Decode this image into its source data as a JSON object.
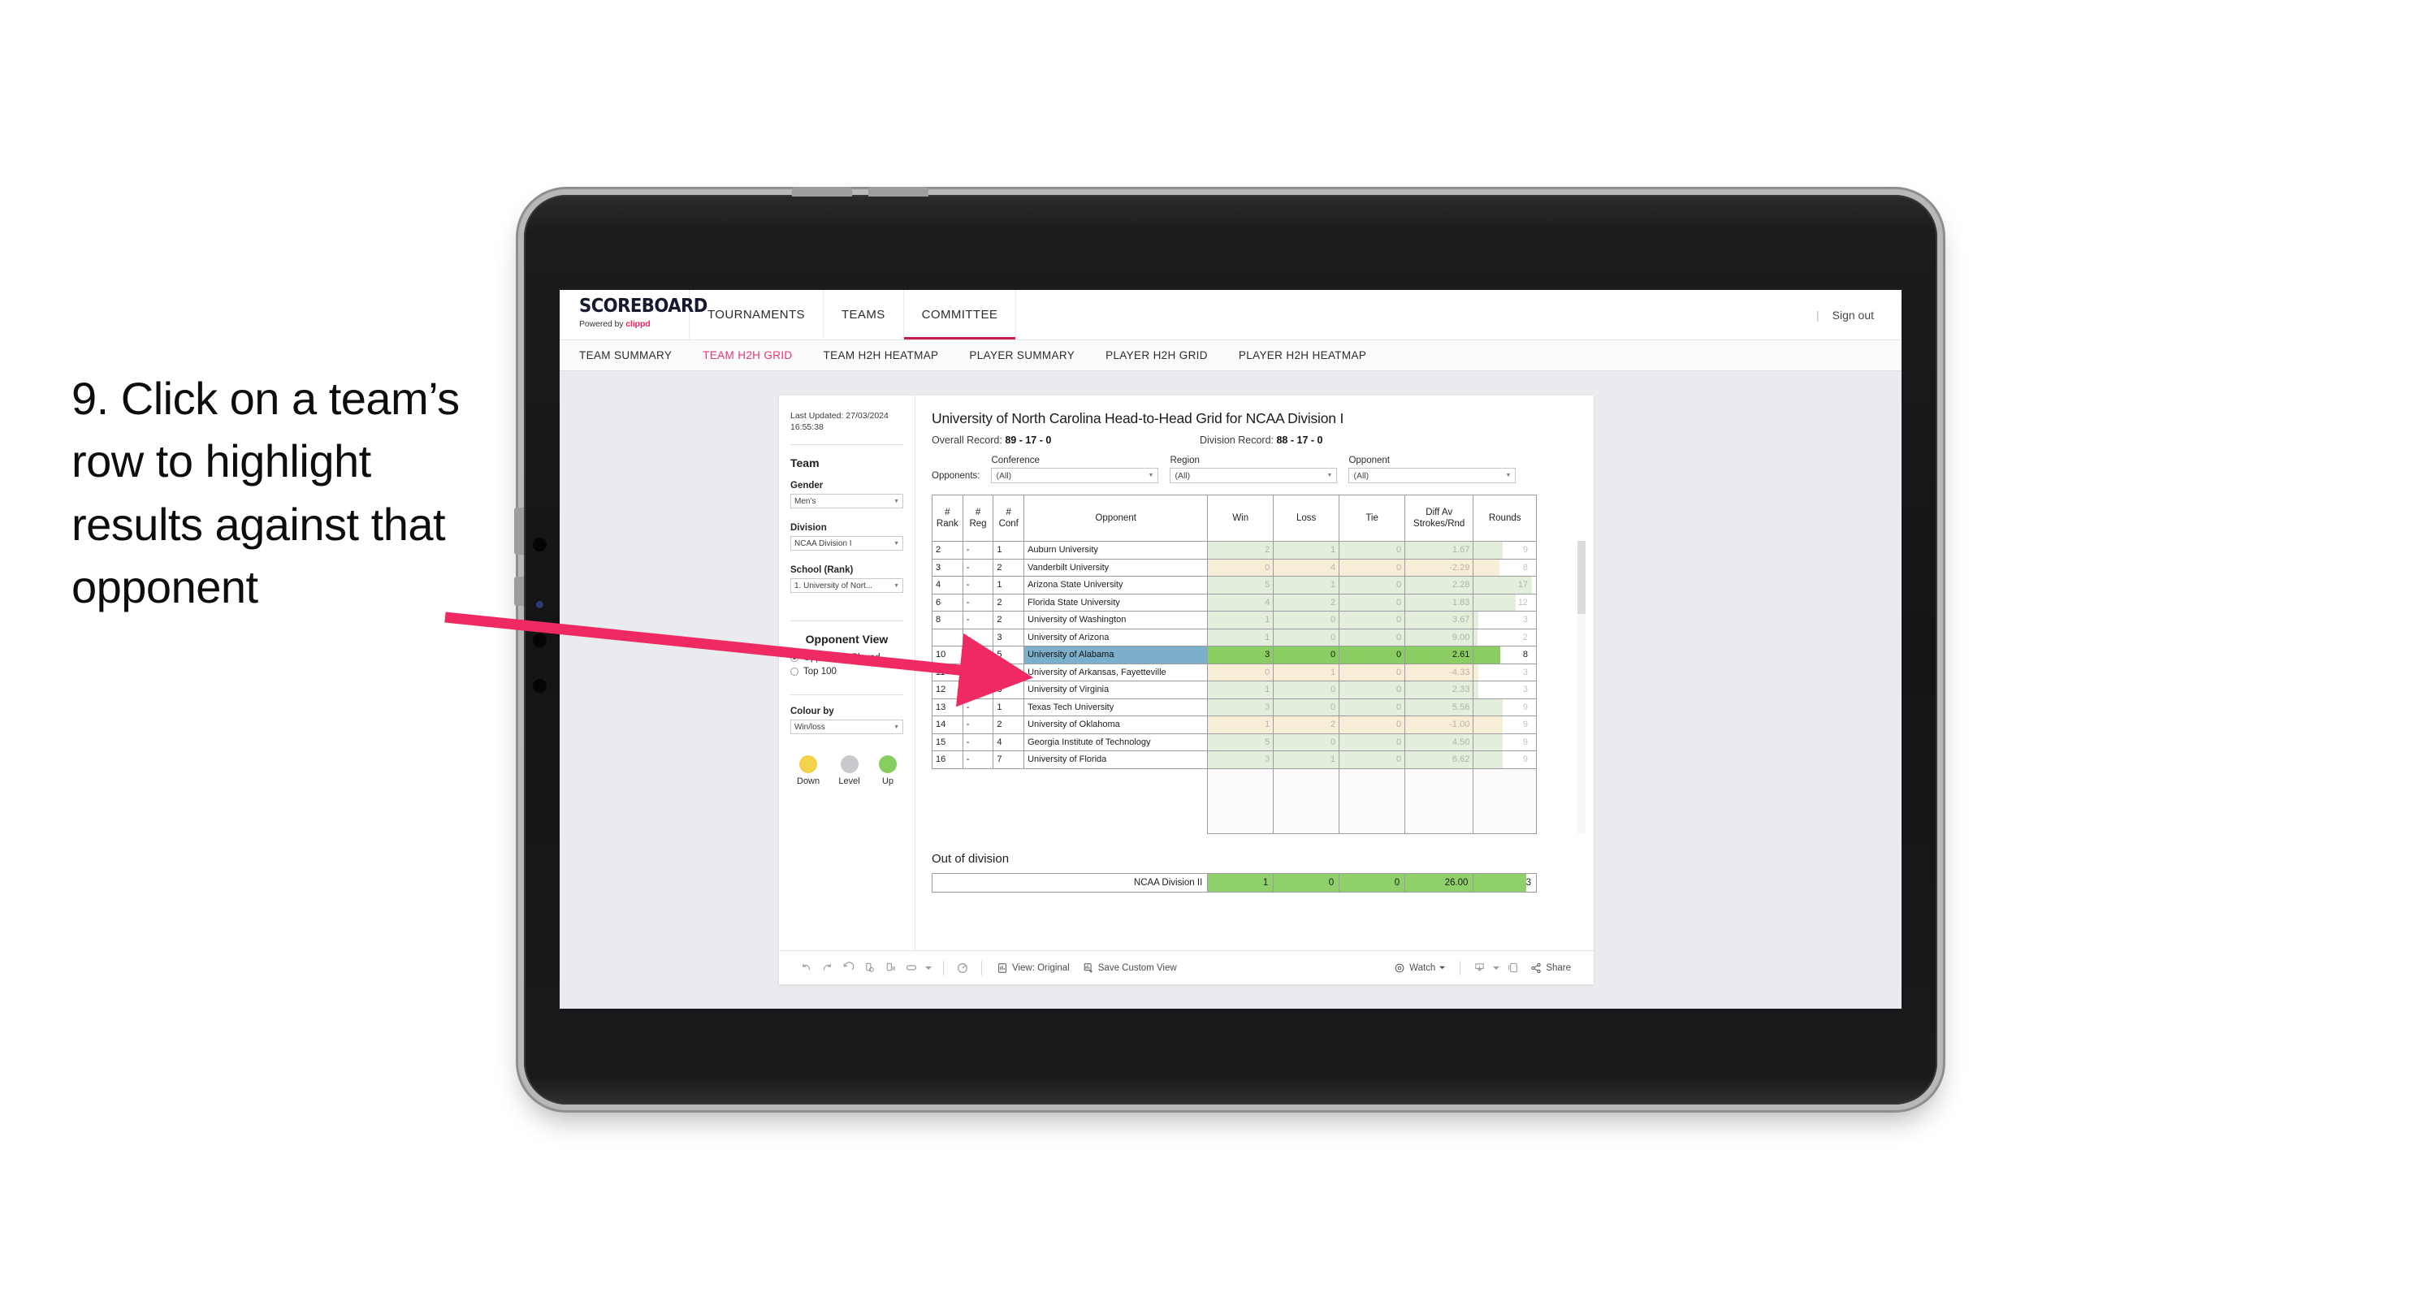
{
  "annotation": {
    "text": "9. Click on a team’s row to highlight results against that opponent",
    "arrow_color": "#ef2a62"
  },
  "topnav": {
    "brand_title": "SCOREBOARD",
    "brand_sub_prefix": "Powered by ",
    "brand_sub_name": "clippd",
    "items": [
      {
        "label": "TOURNAMENTS",
        "active": false
      },
      {
        "label": "TEAMS",
        "active": false
      },
      {
        "label": "COMMITTEE",
        "active": true
      }
    ],
    "divider": "|",
    "sign_out": "Sign out"
  },
  "subnav": {
    "items": [
      {
        "label": "TEAM SUMMARY",
        "active": false
      },
      {
        "label": "TEAM H2H GRID",
        "active": true
      },
      {
        "label": "TEAM H2H HEATMAP",
        "active": false
      },
      {
        "label": "PLAYER SUMMARY",
        "active": false
      },
      {
        "label": "PLAYER H2H GRID",
        "active": false
      },
      {
        "label": "PLAYER H2H HEATMAP",
        "active": false
      }
    ]
  },
  "filters": {
    "last_updated": "Last Updated: 27/03/2024 16:55:38",
    "team_heading": "Team",
    "gender_label": "Gender",
    "gender_value": "Men’s",
    "division_label": "Division",
    "division_value": "NCAA Division I",
    "school_label": "School (Rank)",
    "school_value": "1. University of Nort...",
    "opponent_view_heading": "Opponent View",
    "opponent_view_options": [
      {
        "label": "Opponents Played",
        "selected": true
      },
      {
        "label": "Top 100",
        "selected": false
      }
    ],
    "colour_by_label": "Colour by",
    "colour_by_value": "Win/loss",
    "legend": [
      {
        "label": "Down",
        "color": "#f2d24b"
      },
      {
        "label": "Level",
        "color": "#c7c9cc"
      },
      {
        "label": "Up",
        "color": "#86ce5f"
      }
    ]
  },
  "content": {
    "title": "University of North Carolina Head-to-Head Grid for NCAA Division I",
    "overall_record_label": "Overall Record: ",
    "overall_record_value": "89 - 17 - 0",
    "division_record_label": "Division Record: ",
    "division_record_value": "88 - 17 - 0",
    "opponents_label": "Opponents:",
    "filter_selects": [
      {
        "label": "Conference",
        "value": "(All)"
      },
      {
        "label": "Region",
        "value": "(All)"
      },
      {
        "label": "Opponent",
        "value": "(All)"
      }
    ],
    "out_of_division_title": "Out of division",
    "out_of_division_row": {
      "name": "NCAA Division II",
      "win": "1",
      "loss": "0",
      "tie": "0",
      "diff": "26.00",
      "rounds": "3",
      "rounds_bar_pct": 84
    }
  },
  "chart_data": {
    "type": "table",
    "title": "University of North Carolina Head-to-Head Grid for NCAA Division I",
    "columns": [
      "# Rank",
      "# Reg",
      "# Conf",
      "Opponent",
      "Win",
      "Loss",
      "Tie",
      "Diff Av Strokes/Rnd",
      "Rounds"
    ],
    "column_header_lines": [
      [
        "#",
        "Rank"
      ],
      [
        "#",
        "Reg"
      ],
      [
        "#",
        "Conf"
      ],
      [
        "Opponent"
      ],
      [
        "Win"
      ],
      [
        "Loss"
      ],
      [
        "Tie"
      ],
      [
        "Diff Av",
        "Strokes/Rnd"
      ],
      [
        "Rounds"
      ]
    ],
    "selected_row_index": 6,
    "rows": [
      {
        "rank": "2",
        "reg": "-",
        "conf": "1",
        "opponent": "Auburn University",
        "win": "2",
        "loss": "1",
        "tie": "0",
        "diff": "1.67",
        "rounds": "9",
        "tone": "green",
        "rounds_bar_pct": 46
      },
      {
        "rank": "3",
        "reg": "-",
        "conf": "2",
        "opponent": "Vanderbilt University",
        "win": "0",
        "loss": "4",
        "tie": "0",
        "diff": "-2.29",
        "rounds": "8",
        "tone": "yellow",
        "rounds_bar_pct": 41
      },
      {
        "rank": "4",
        "reg": "-",
        "conf": "1",
        "opponent": "Arizona State University",
        "win": "5",
        "loss": "1",
        "tie": "0",
        "diff": "2.28",
        "rounds": "17",
        "tone": "green",
        "rounds_bar_pct": 94
      },
      {
        "rank": "6",
        "reg": "-",
        "conf": "2",
        "opponent": "Florida State University",
        "win": "4",
        "loss": "2",
        "tie": "0",
        "diff": "1.83",
        "rounds": "12",
        "tone": "green",
        "rounds_bar_pct": 68
      },
      {
        "rank": "8",
        "reg": "-",
        "conf": "2",
        "opponent": "University of Washington",
        "win": "1",
        "loss": "0",
        "tie": "0",
        "diff": "3.67",
        "rounds": "3",
        "tone": "green",
        "rounds_bar_pct": 8
      },
      {
        "rank": "",
        "reg": "-",
        "conf": "3",
        "opponent": "University of Arizona",
        "win": "1",
        "loss": "0",
        "tie": "0",
        "diff": "9.00",
        "rounds": "2",
        "tone": "green",
        "rounds_bar_pct": 6
      },
      {
        "rank": "10",
        "reg": "-",
        "conf": "5",
        "opponent": "University of Alabama",
        "win": "3",
        "loss": "0",
        "tie": "0",
        "diff": "2.61",
        "rounds": "8",
        "tone": "selected",
        "rounds_bar_pct": 42
      },
      {
        "rank": "11",
        "reg": "-",
        "conf": "6",
        "opponent": "University of Arkansas, Fayetteville",
        "win": "0",
        "loss": "1",
        "tie": "0",
        "diff": "-4.33",
        "rounds": "3",
        "tone": "yellow",
        "rounds_bar_pct": 8
      },
      {
        "rank": "12",
        "reg": "-",
        "conf": "3",
        "opponent": "University of Virginia",
        "win": "1",
        "loss": "0",
        "tie": "0",
        "diff": "2.33",
        "rounds": "3",
        "tone": "green",
        "rounds_bar_pct": 8
      },
      {
        "rank": "13",
        "reg": "-",
        "conf": "1",
        "opponent": "Texas Tech University",
        "win": "3",
        "loss": "0",
        "tie": "0",
        "diff": "5.56",
        "rounds": "9",
        "tone": "green",
        "rounds_bar_pct": 46
      },
      {
        "rank": "14",
        "reg": "-",
        "conf": "2",
        "opponent": "University of Oklahoma",
        "win": "1",
        "loss": "2",
        "tie": "0",
        "diff": "-1.00",
        "rounds": "9",
        "tone": "yellow",
        "rounds_bar_pct": 46
      },
      {
        "rank": "15",
        "reg": "-",
        "conf": "4",
        "opponent": "Georgia Institute of Technology",
        "win": "5",
        "loss": "0",
        "tie": "0",
        "diff": "4.50",
        "rounds": "9",
        "tone": "green",
        "rounds_bar_pct": 46
      },
      {
        "rank": "16",
        "reg": "-",
        "conf": "7",
        "opponent": "University of Florida",
        "win": "3",
        "loss": "1",
        "tie": "0",
        "diff": "6.62",
        "rounds": "9",
        "tone": "green",
        "rounds_bar_pct": 46
      }
    ]
  },
  "toolbar": {
    "icons": [
      "undo-icon",
      "redo-icon",
      "revert-icon",
      "refresh-data-icon",
      "pause-updates-icon",
      "loop-icon",
      "caret-down-icon"
    ],
    "alerts_icon": "alerts-icon",
    "view_original": "View: Original",
    "save_custom_view": "Save Custom View",
    "watch": "Watch",
    "download_icon": "download-icon",
    "fullscreen_icon": "fullscreen-icon",
    "share": "Share"
  }
}
